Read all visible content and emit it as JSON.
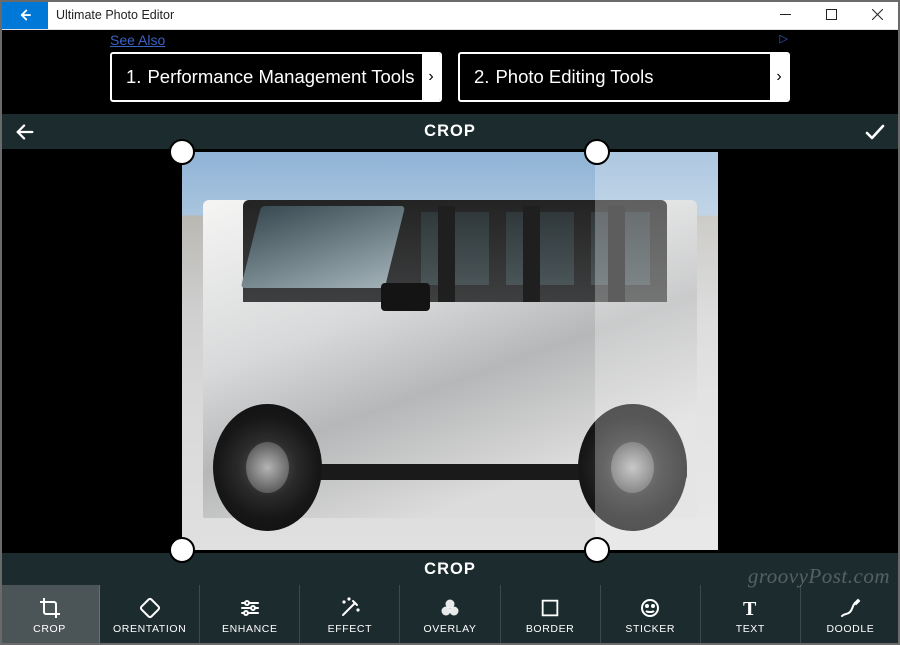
{
  "window": {
    "title": "Ultimate Photo Editor"
  },
  "ads": {
    "see_also": "See Also",
    "info_glyph": "▷",
    "items": [
      {
        "num": "1.",
        "label": "Performance Management Tools"
      },
      {
        "num": "2.",
        "label": "Photo Editing Tools"
      }
    ]
  },
  "crop": {
    "title_top": "CROP",
    "title_bottom": "CROP"
  },
  "toolbar": {
    "items": [
      {
        "id": "crop",
        "label": "CROP",
        "active": true
      },
      {
        "id": "orientation",
        "label": "ORENTATION",
        "active": false
      },
      {
        "id": "enhance",
        "label": "ENHANCE",
        "active": false
      },
      {
        "id": "effect",
        "label": "EFFECT",
        "active": false
      },
      {
        "id": "overlay",
        "label": "OVERLAY",
        "active": false
      },
      {
        "id": "border",
        "label": "BORDER",
        "active": false
      },
      {
        "id": "sticker",
        "label": "STICKER",
        "active": false
      },
      {
        "id": "text",
        "label": "TEXT",
        "active": false
      },
      {
        "id": "doodle",
        "label": "DOODLE",
        "active": false
      }
    ]
  },
  "watermark": "groovyPost.com"
}
